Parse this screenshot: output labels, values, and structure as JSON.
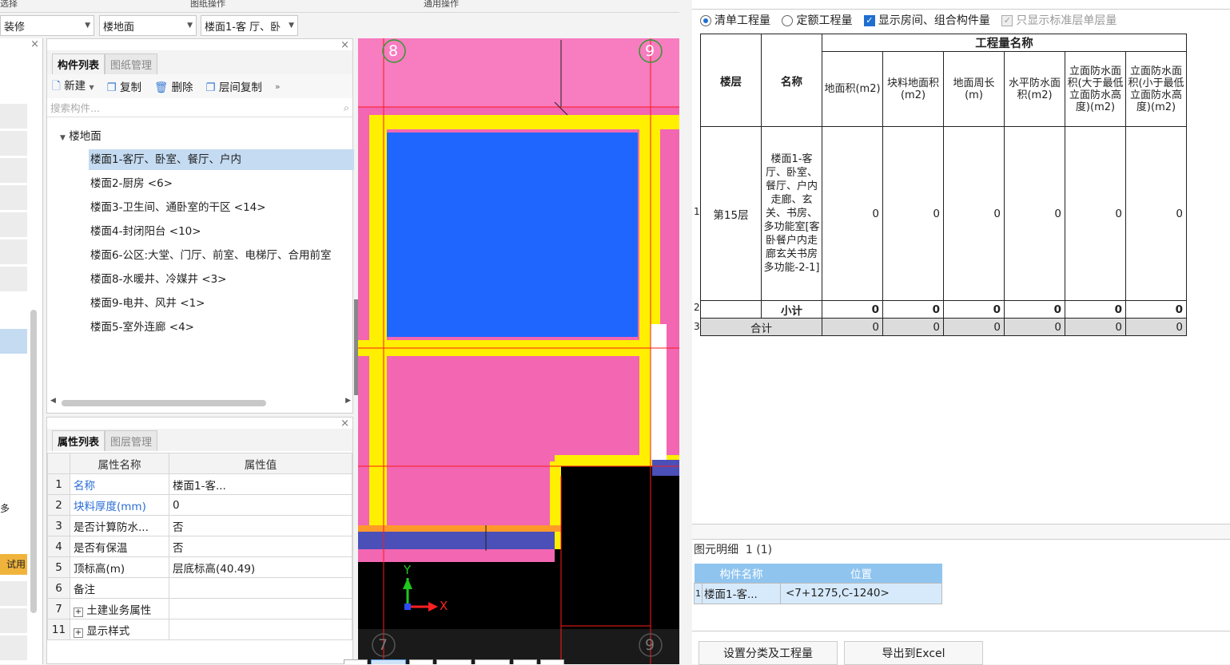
{
  "top": {
    "left_label": "选择",
    "mid_label": "图纸操作",
    "right_label": "通用操作"
  },
  "selectors": {
    "category": "装修",
    "type": "楼地面",
    "item": "楼面1-客 厅、卧"
  },
  "left_strip": {
    "trial": "试用",
    "symbol": "多"
  },
  "component_panel": {
    "tabs": [
      "构件列表",
      "图纸管理"
    ],
    "toolbar": {
      "new": "新建",
      "copy": "复制",
      "delete": "删除",
      "floor_copy": "层间复制",
      "more": "»"
    },
    "search_placeholder": "搜索构件...",
    "tree_root": "楼地面",
    "items": [
      "楼面1-客厅、卧室、餐厅、户内",
      "楼面2-厨房 <6>",
      "楼面3-卫生间、通卧室的干区 <14>",
      "楼面4-封闭阳台 <10>",
      "楼面6-公区:大堂、门厅、前室、电梯厅、合用前室",
      "楼面8-水暖井、冷媒井 <3>",
      "楼面9-电井、风井 <1>",
      "楼面5-室外连廊 <4>"
    ]
  },
  "property_panel": {
    "tabs": [
      "属性列表",
      "图层管理"
    ],
    "headers": [
      "属性名称",
      "属性值"
    ],
    "rows": [
      {
        "num": "1",
        "name": "名称",
        "value": "楼面1-客..."
      },
      {
        "num": "2",
        "name": "块料厚度(mm)",
        "value": "0"
      },
      {
        "num": "3",
        "name": "是否计算防水...",
        "value": "否"
      },
      {
        "num": "4",
        "name": "是否有保温",
        "value": "否"
      },
      {
        "num": "5",
        "name": "顶标高(m)",
        "value": "层底标高(40.49)"
      },
      {
        "num": "6",
        "name": "备注",
        "value": ""
      },
      {
        "num": "7",
        "name": "土建业务属性",
        "value": ""
      },
      {
        "num": "11",
        "name": "显示样式",
        "value": ""
      }
    ]
  },
  "cad": {
    "axis_top": [
      "8",
      "9"
    ],
    "axis_bottom": [
      "7",
      "9"
    ],
    "y_label": "Y",
    "x_label": "X"
  },
  "report": {
    "options": {
      "r1": "清单工程量",
      "r2": "定额工程量",
      "c1": "显示房间、组合构件量",
      "c2": "只显示标准层单层量"
    },
    "group_header": "工程量名称",
    "col_floor": "楼层",
    "col_name": "名称",
    "cols": [
      "地面积(m2)",
      "块料地面积(m2)",
      "地面周长(m)",
      "水平防水面积(m2)",
      "立面防水面积(大于最低立面防水高度)(m2)",
      "立面防水面积(小于最低立面防水高度)(m2)"
    ],
    "rows": [
      {
        "num": "1",
        "floor": "第15层",
        "name": "楼面1-客厅、卧室、餐厅、户内走廊、玄关、书房、多功能室[客卧餐户内走廊玄关书房多功能-2-1]",
        "values": [
          "0",
          "0",
          "0",
          "0",
          "0",
          "0"
        ]
      },
      {
        "num": "2",
        "floor": "",
        "name": "小计",
        "values": [
          "0",
          "0",
          "0",
          "0",
          "0",
          "0"
        ]
      },
      {
        "num": "3",
        "floor": "",
        "name": "合计",
        "values": [
          "0",
          "0",
          "0",
          "0",
          "0",
          "0"
        ]
      }
    ],
    "detail_title": "图元明细",
    "detail_count": "1 (1)",
    "detail_headers": [
      "构件名称",
      "位置"
    ],
    "detail_row": {
      "num": "1",
      "name": "楼面1-客...",
      "pos": "<7+1275,C-1240>"
    },
    "buttons": [
      "设置分类及工程量",
      "导出到Excel"
    ]
  }
}
